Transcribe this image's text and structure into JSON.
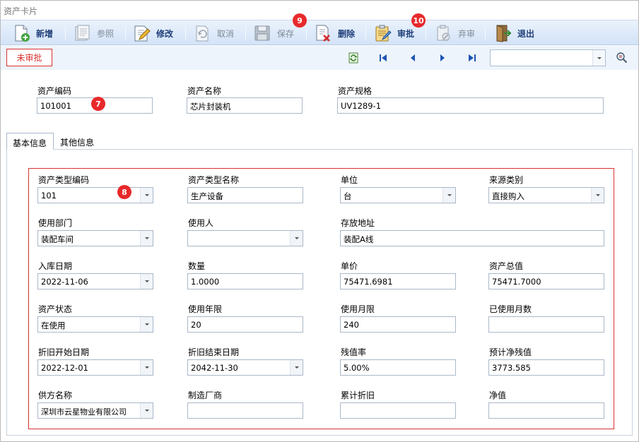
{
  "window": {
    "title": "资产卡片"
  },
  "toolbar": {
    "buttons": [
      {
        "label": "新增",
        "icon": "add-document-icon"
      },
      {
        "label": "参照",
        "icon": "reference-icon"
      },
      {
        "label": "修改",
        "icon": "edit-icon"
      },
      {
        "label": "取消",
        "icon": "cancel-icon"
      },
      {
        "label": "保存",
        "icon": "save-icon"
      },
      {
        "label": "删除",
        "icon": "delete-icon"
      },
      {
        "label": "审批",
        "icon": "approve-icon"
      },
      {
        "label": "弃审",
        "icon": "unapprove-icon"
      },
      {
        "label": "退出",
        "icon": "exit-icon"
      }
    ]
  },
  "status": {
    "label": "未审批",
    "color": "#d9332f"
  },
  "badges": {
    "b7": "7",
    "b8": "8",
    "b9": "9",
    "b10": "10"
  },
  "header": {
    "asset_code": {
      "label": "资产编码",
      "value": "101001"
    },
    "asset_name": {
      "label": "资产名称",
      "value": "芯片封装机"
    },
    "asset_spec": {
      "label": "资产规格",
      "value": "UV1289-1"
    }
  },
  "tabs": [
    "基本信息",
    "其他信息"
  ],
  "form": {
    "type_code": {
      "label": "资产类型编码",
      "value": "101"
    },
    "type_name": {
      "label": "资产类型名称",
      "value": "生产设备"
    },
    "unit": {
      "label": "单位",
      "value": "台"
    },
    "source": {
      "label": "来源类别",
      "value": "直接购入"
    },
    "dept": {
      "label": "使用部门",
      "value": "装配车间"
    },
    "user": {
      "label": "使用人",
      "value": ""
    },
    "location": {
      "label": "存放地址",
      "value": "装配A线"
    },
    "in_date": {
      "label": "入库日期",
      "value": "2022-11-06"
    },
    "quantity": {
      "label": "数量",
      "value": "1.0000"
    },
    "unit_price": {
      "label": "单价",
      "value": "75471.6981"
    },
    "total": {
      "label": "资产总值",
      "value": "75471.7000"
    },
    "state": {
      "label": "资产状态",
      "value": "在使用"
    },
    "years": {
      "label": "使用年限",
      "value": "20"
    },
    "months": {
      "label": "使用月限",
      "value": "240"
    },
    "used_months": {
      "label": "已使用月数",
      "value": ""
    },
    "dep_start": {
      "label": "折旧开始日期",
      "value": "2022-12-01"
    },
    "dep_end": {
      "label": "折旧结束日期",
      "value": "2042-11-30"
    },
    "residual_rate": {
      "label": "残值率",
      "value": "5.00%"
    },
    "residual_value": {
      "label": "预计净残值",
      "value": "3773.585"
    },
    "supplier": {
      "label": "供方名称",
      "value": "深圳市云星物业有限公司"
    },
    "manufacturer": {
      "label": "制造厂商",
      "value": ""
    },
    "acc_dep": {
      "label": "累计折旧",
      "value": ""
    },
    "net_value": {
      "label": "净值",
      "value": ""
    }
  }
}
